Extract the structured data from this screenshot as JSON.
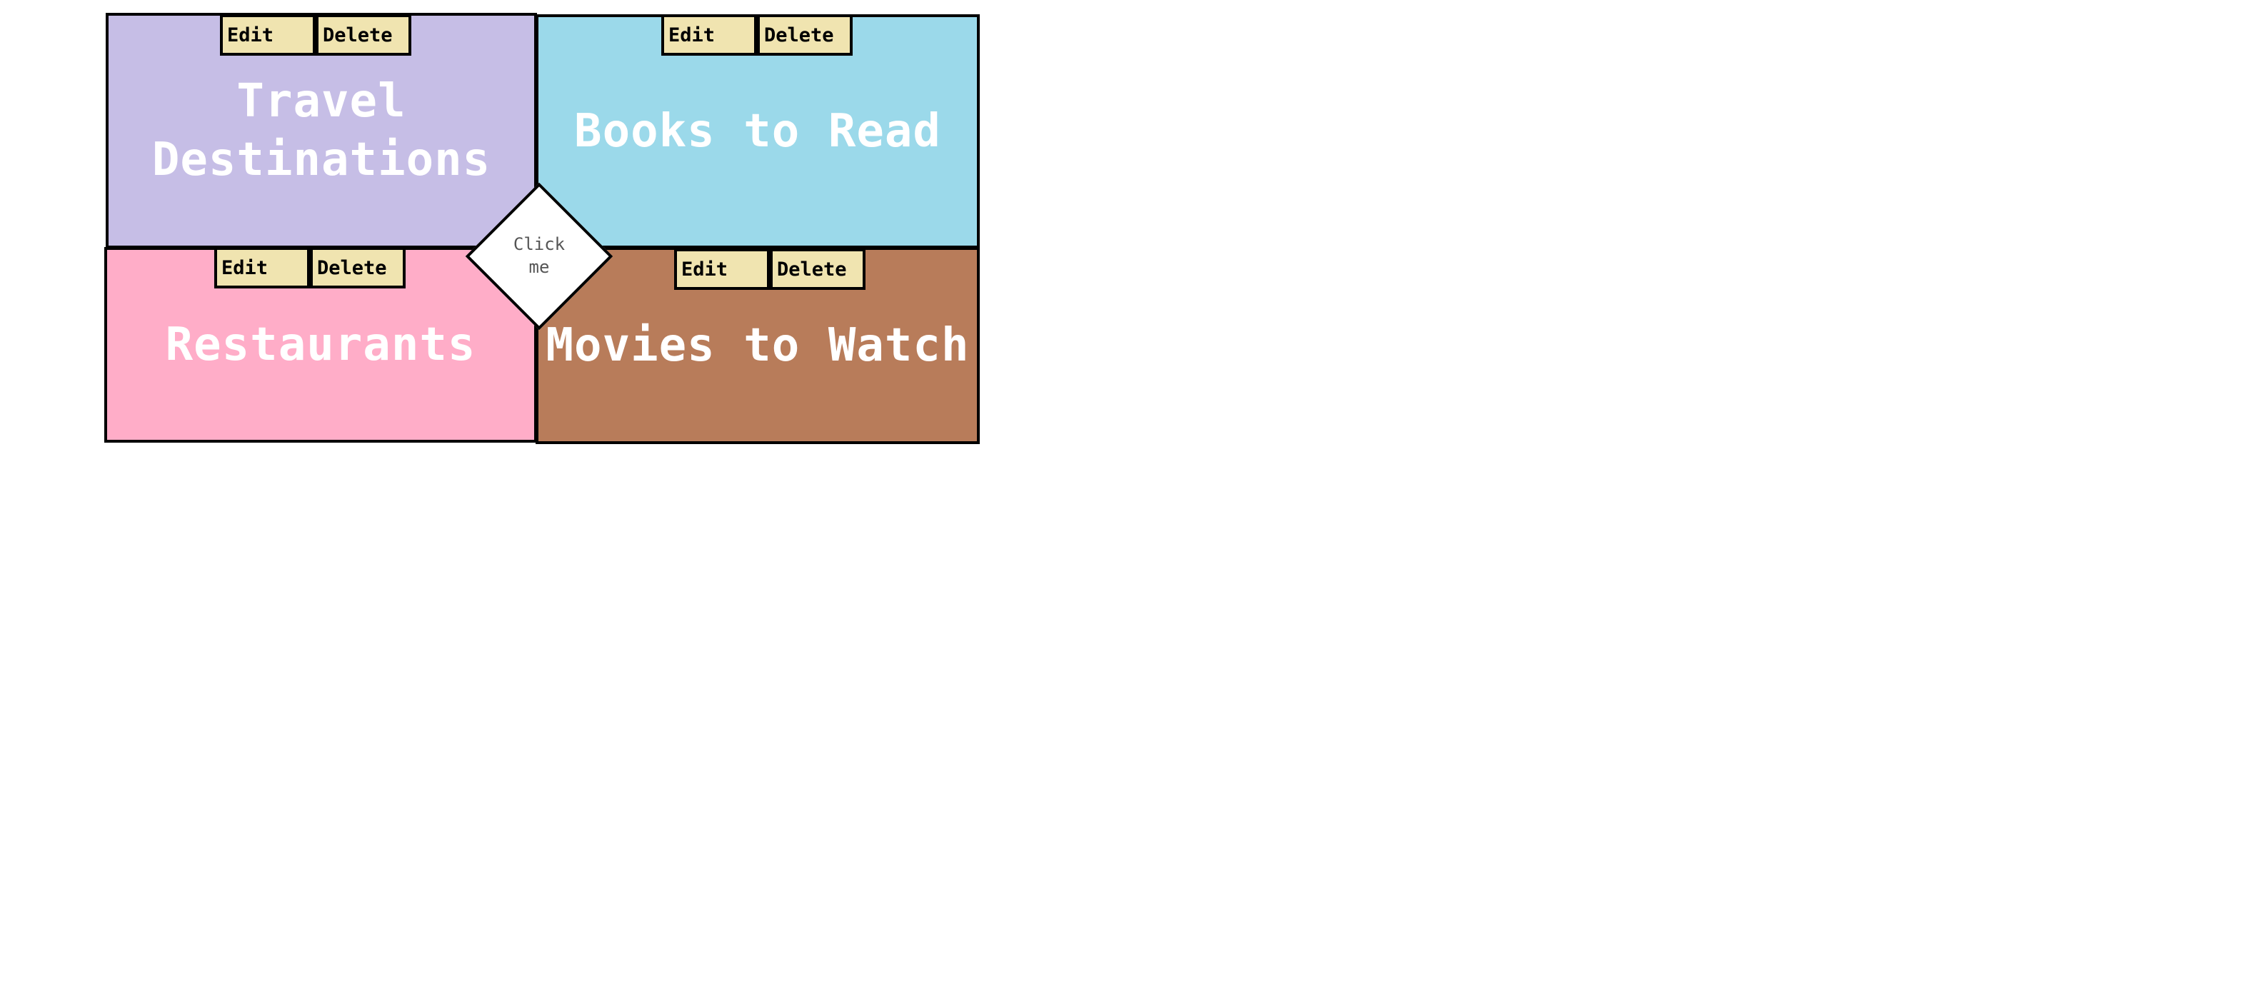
{
  "panels": {
    "travel": {
      "title_line1": "Travel",
      "title_line2": "Destinations",
      "color": "#c6bee6"
    },
    "books": {
      "title": "Books to Read",
      "color": "#9bd9ea"
    },
    "restaurants": {
      "title": "Restaurants",
      "color": "#ffadc8"
    },
    "movies": {
      "title": "Movies to Watch",
      "color": "#b87c5a"
    }
  },
  "buttons": {
    "edit_label": "Edit",
    "delete_label": "Delete",
    "color": "#f0e4b0"
  },
  "center_button": {
    "line1": "Click",
    "line2": "me"
  }
}
